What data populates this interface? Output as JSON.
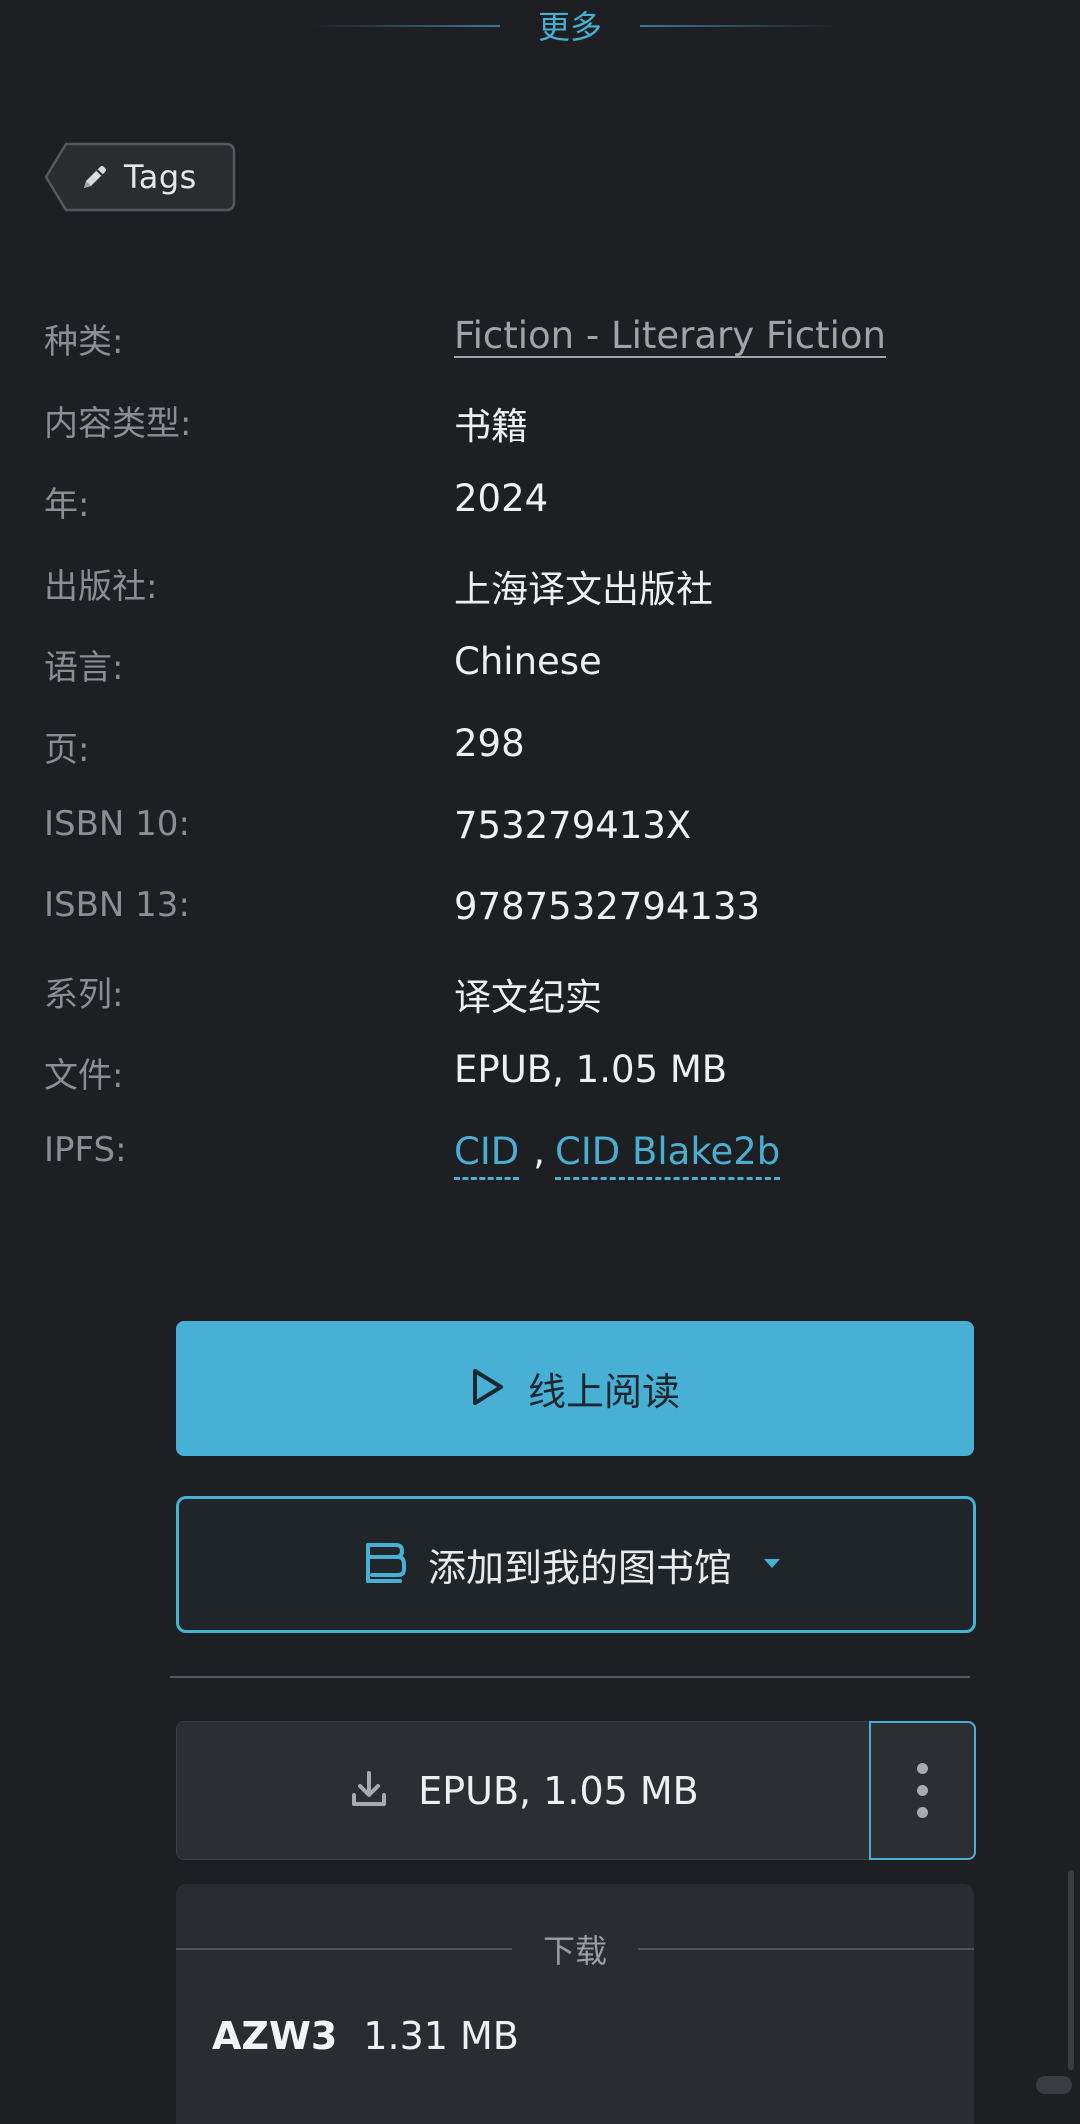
{
  "section_header": {
    "label": "更多"
  },
  "tags_button": {
    "label": "Tags",
    "icon": "pencil-icon"
  },
  "metadata": [
    {
      "key": "category",
      "label": "种类:",
      "value": "Fiction - Literary Fiction",
      "link": true
    },
    {
      "key": "content-type",
      "label": "内容类型:",
      "value": "书籍"
    },
    {
      "key": "year",
      "label": "年:",
      "value": "2024"
    },
    {
      "key": "publisher",
      "label": "出版社:",
      "value": "上海译文出版社"
    },
    {
      "key": "language",
      "label": "语言:",
      "value": "Chinese"
    },
    {
      "key": "pages",
      "label": "页:",
      "value": "298"
    },
    {
      "key": "isbn10",
      "label": "ISBN 10:",
      "value": "753279413X"
    },
    {
      "key": "isbn13",
      "label": "ISBN 13:",
      "value": "9787532794133"
    },
    {
      "key": "series",
      "label": "系列:",
      "value": "译文纪实"
    },
    {
      "key": "file",
      "label": "文件:",
      "value": "EPUB, 1.05 MB"
    }
  ],
  "ipfs": {
    "label": "IPFS:",
    "cid": "CID",
    "separator": ",",
    "cid_blake": "CID Blake2b"
  },
  "read_button": {
    "label": "线上阅读",
    "icon": "play-icon"
  },
  "library_button": {
    "label": "添加到我的图书馆",
    "icon": "library-icon",
    "caret": "caret-down-icon"
  },
  "download_button": {
    "label": "EPUB, 1.05 MB",
    "icon": "download-icon"
  },
  "download_panel": {
    "title": "下载",
    "formats": [
      {
        "name": "AZW3",
        "size": "1.31 MB"
      }
    ]
  },
  "colors": {
    "background": "#1e1f23",
    "accent": "#47b0d4",
    "muted_text": "#8b8e94"
  }
}
